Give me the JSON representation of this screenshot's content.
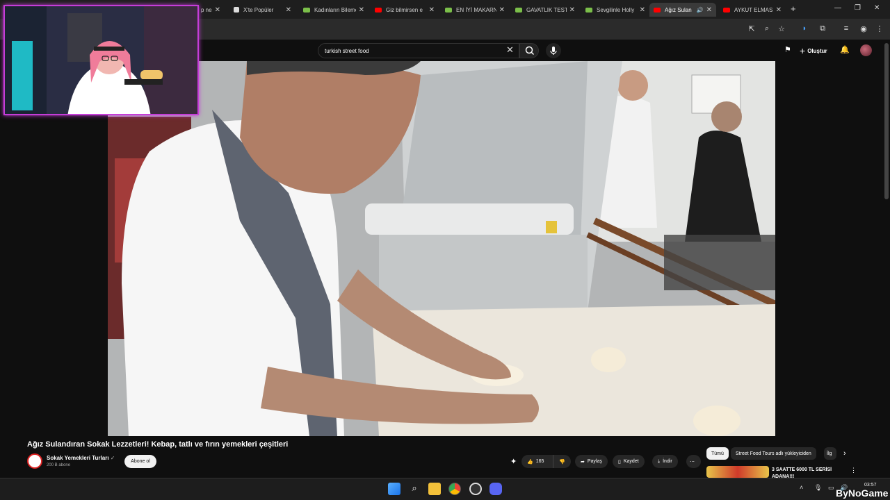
{
  "browser": {
    "tabs": [
      {
        "title": "p ne",
        "active": false
      },
      {
        "title": "X'te Popüler",
        "active": false
      },
      {
        "title": "Kadınların Bilemeyeceği",
        "active": false
      },
      {
        "title": "Giz bilmirsen e",
        "active": false
      },
      {
        "title": "EN İYİ MAKARNA",
        "active": false
      },
      {
        "title": "GAVATLIK TESTİ",
        "active": false
      },
      {
        "title": "Sevgilinle Holly",
        "active": false
      },
      {
        "title": "Ağız Sulan",
        "active": true
      },
      {
        "title": "AYKUT ELMAS",
        "active": false
      }
    ],
    "new_tab": "+",
    "close": "✕"
  },
  "youtube": {
    "search_value": "turkish street food",
    "create_label": "Oluştur"
  },
  "video": {
    "title": "Ağız Sulandıran Sokak Lezzetleri! Kebap, tatlı ve fırın yemekleri çeşitleri",
    "channel": "Sokak Yemekleri Turları",
    "subscribers": "200 B abone",
    "subscribe_label": "Abone ol",
    "likes": "165",
    "share_label": "Paylaş",
    "save_label": "Kaydet",
    "download_label": "İndir",
    "more": "⋯"
  },
  "recommendations": {
    "chips": [
      "Tümü",
      "Street Food Tours adlı yükleyiciden",
      "İlg"
    ],
    "first_title": "3 SAATTE 6000 TL SERİSİ ADANA!!!"
  },
  "taskbar": {
    "time": "03:57",
    "watermark": "ByNoGame"
  },
  "colors": {
    "webcam_border": "#c53dd8",
    "youtube_red": "#ff0000"
  }
}
